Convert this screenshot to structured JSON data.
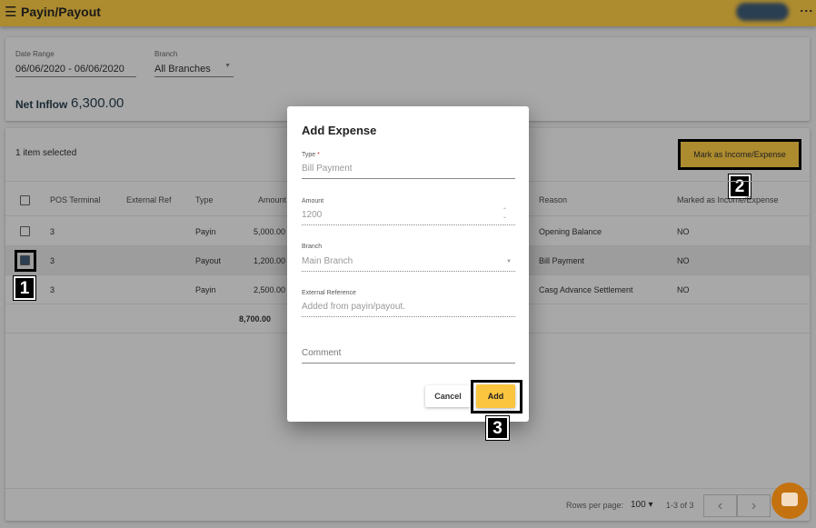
{
  "header": {
    "title": "Payin/Payout",
    "menu_icon": "hamburger-icon",
    "more_icon": "kebab-icon",
    "color": "#ad8b2f"
  },
  "filters": {
    "date_range_label": "Date Range",
    "date_range_value": "06/06/2020 - 06/06/2020",
    "branch_label": "Branch",
    "branch_value": "All Branches"
  },
  "net_inflow": {
    "label": "Net Inflow",
    "value": "6,300.00"
  },
  "table": {
    "selected_text": "1 item selected",
    "mark_button": "Mark as Income/Expense",
    "columns": [
      "POS Terminal",
      "External Ref",
      "Type",
      "Amount",
      "Reason",
      "Marked as Income/Expense"
    ],
    "rows": [
      {
        "pos": "3",
        "ext": "",
        "type": "Payin",
        "amount": "5,000.00",
        "reason": "Opening Balance",
        "marked": "NO",
        "checked": false
      },
      {
        "pos": "3",
        "ext": "",
        "type": "Payout",
        "amount": "1,200.00",
        "reason": "Bill Payment",
        "marked": "NO",
        "checked": true
      },
      {
        "pos": "3",
        "ext": "",
        "type": "Payin",
        "amount": "2,500.00",
        "reason": "Casg Advance Settlement",
        "marked": "NO",
        "checked": false
      }
    ],
    "total": "8,700.00"
  },
  "pagination": {
    "rows_per_page_label": "Rows per page:",
    "rows_per_page": "100",
    "range": "1-3 of 3"
  },
  "dialog": {
    "title": "Add Expense",
    "type_label": "Type",
    "required": "*",
    "type_value": "Bill Payment",
    "amount_label": "Amount",
    "amount_value": "1200",
    "branch_label": "Branch",
    "branch_value": "Main Branch",
    "extref_label": "External Reference",
    "extref_value": "Added from payin/payout.",
    "comment_placeholder": "Comment",
    "cancel": "Cancel",
    "add": "Add"
  },
  "annotations": [
    "1",
    "2",
    "3"
  ],
  "accent": "#fbc540"
}
